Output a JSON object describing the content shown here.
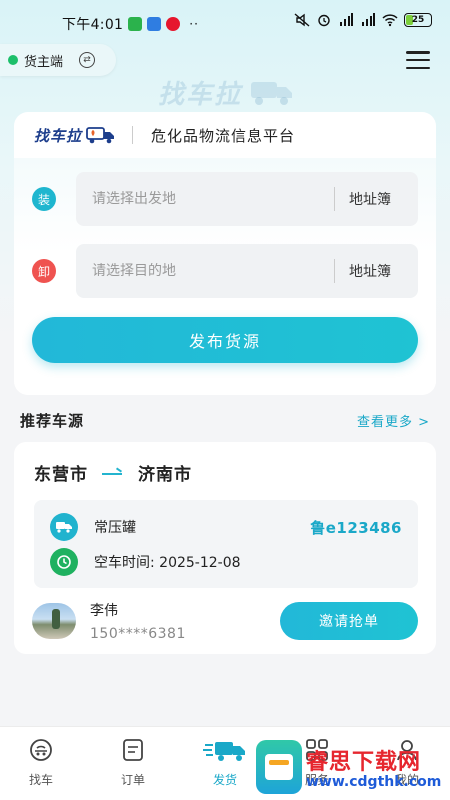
{
  "status_bar": {
    "time": "下午4:01",
    "battery": "25",
    "dots": "··"
  },
  "header": {
    "role_label": "货主端",
    "watermark_text": "找车拉"
  },
  "card": {
    "brand": "找车拉",
    "subtitle": "危化品物流信息平台",
    "load_badge": "装",
    "load_placeholder": "请选择出发地",
    "unload_badge": "卸",
    "unload_placeholder": "请选择目的地",
    "address_book_label": "地址簿",
    "publish_label": "发布货源"
  },
  "recommend": {
    "title": "推荐车源",
    "see_more": "查看更多 >",
    "vehicle": {
      "from": "东营市",
      "to": "济南市",
      "type": "常压罐",
      "plate": "鲁e123486",
      "empty_time_label": "空车时间: 2025-12-08",
      "contact_name": "李伟",
      "contact_phone": "150****6381",
      "invite_label": "邀请抢单"
    }
  },
  "bottom_nav": {
    "items": [
      {
        "label": "找车",
        "icon": "find-truck-icon"
      },
      {
        "label": "订单",
        "icon": "order-icon"
      },
      {
        "label": "发货",
        "icon": "ship-icon"
      },
      {
        "label": "服务",
        "icon": "service-icon"
      },
      {
        "label": "我的",
        "icon": "profile-icon"
      }
    ],
    "active_index": 2
  },
  "watermark": {
    "site_name": "睿思下载网",
    "site_url": "www.cdgthk.com"
  },
  "colors": {
    "accent": "#1aa8c8",
    "load_badge": "#1fb6cf",
    "unload_badge": "#ef5350",
    "online_dot": "#1cbf6a"
  }
}
